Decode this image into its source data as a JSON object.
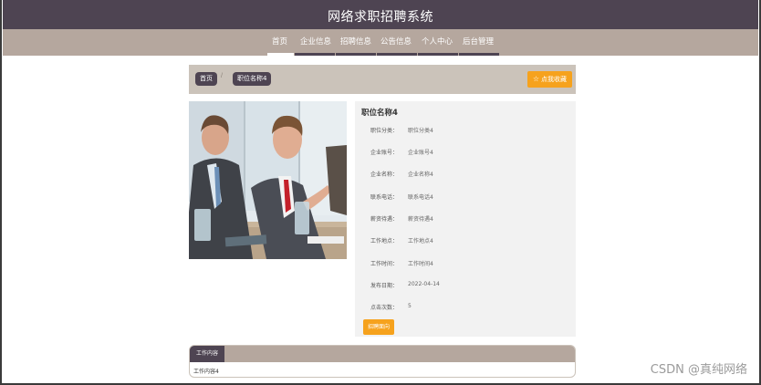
{
  "header": {
    "title": "网络求职招聘系统"
  },
  "nav": {
    "items": [
      {
        "label": "首页",
        "active": true
      },
      {
        "label": "企业信息",
        "active": false
      },
      {
        "label": "招聘信息",
        "active": false
      },
      {
        "label": "公告信息",
        "active": false
      },
      {
        "label": "个人中心",
        "active": false
      },
      {
        "label": "后台管理",
        "active": false
      }
    ]
  },
  "breadcrumb": {
    "home": "首页",
    "separator": "/",
    "current": "职位名称4",
    "favorite_label": "点我收藏",
    "favorite_icon": "star-icon"
  },
  "job": {
    "title": "职位名称4",
    "fields": [
      {
        "label": "职位分类：",
        "value": "职位分类4"
      },
      {
        "label": "企业账号：",
        "value": "企业账号4"
      },
      {
        "label": "企业名称：",
        "value": "企业名称4"
      },
      {
        "label": "联系电话：",
        "value": "联系电话4"
      },
      {
        "label": "薪资待遇：",
        "value": "薪资待遇4"
      },
      {
        "label": "工作地点：",
        "value": "工作地点4"
      },
      {
        "label": "工作时间：",
        "value": "工作时间4"
      },
      {
        "label": "发布日期：",
        "value": "2022-04-14"
      },
      {
        "label": "点击次数：",
        "value": "5"
      }
    ],
    "apply_label": "招聘面向"
  },
  "content": {
    "tab_label": "工作内容",
    "body": "工作内容4"
  },
  "watermark": "CSDN @真纯网络",
  "colors": {
    "header_bg": "#4e4452",
    "nav_bg": "#b5a79e",
    "crumb_bar_bg": "#cbc3ba",
    "accent_orange": "#f6a21d",
    "panel_bg": "#f2f2f2"
  }
}
